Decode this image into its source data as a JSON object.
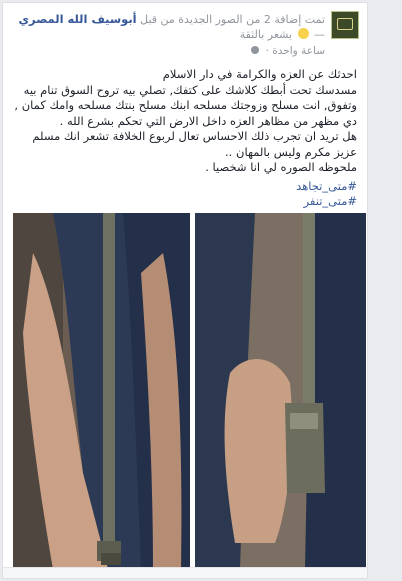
{
  "header": {
    "author_name": "أبوسيف الله المصري",
    "action_text": "تمت إضافة 2 من الصور الجديدة من قبل",
    "feeling_text": "يشعر بالثقة",
    "dash": "—",
    "timestamp": "ساعة واحدة",
    "separator": "·",
    "avatar_icon": "page-logo-icon",
    "globe_icon": "globe-icon"
  },
  "post": {
    "lines": [
      "احدثك عن العزه والكرامة في دار الاسلام",
      "مسدسك تحت أبطك كلاشك على كتفك, تصلي بيه تروح السوق تنام بيه وتفوق, انت مسلح وزوجتك مسلحه ابنك مسلح بنتك مسلحه وامك كمان , دي مظهر من مظاهر العزه داخل الارض التي تحكم بشرع الله .",
      "هل تريد ان تجرب ذلك الاحساس تعال لربوع الخلافة تشعر انك مسلم عزيز مكرم وليس بالمهان ..",
      "ملحوظه الصوره لي انا شخصيا ."
    ]
  },
  "hashtags": [
    "#متى_تجاهد",
    "#متى_تنفر"
  ],
  "colors": {
    "link": "#365899",
    "meta": "#90949c",
    "text": "#1d2129",
    "background": "#e9ebee"
  }
}
